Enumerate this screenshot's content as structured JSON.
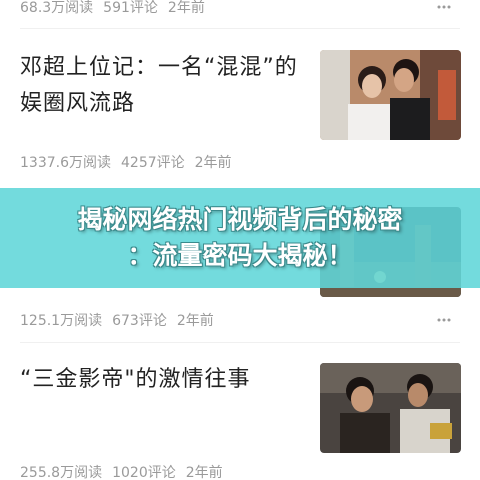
{
  "feed": {
    "items": [
      {
        "title": "",
        "reads": "68.3万阅读",
        "comments": "591评论",
        "time": "2年前"
      },
      {
        "title": "邓超上位记：一名“混混”的娱圈风流路",
        "reads": "1337.6万阅读",
        "comments": "4257评论",
        "time": "2年前"
      },
      {
        "title": "",
        "reads": "125.1万阅读",
        "comments": "673评论",
        "time": "2年前"
      },
      {
        "title": "“三金影帝\"的激情往事",
        "reads": "255.8万阅读",
        "comments": "1020评论",
        "time": "2年前"
      }
    ],
    "more_icon": "more-dots-icon"
  },
  "overlay": {
    "line1": "揭秘网络热门视频背后的秘密",
    "line2": "：流量密码大揭秘！"
  },
  "colors": {
    "overlay_bg": "#60d6d8",
    "meta_text": "#9a9a9a",
    "title_text": "#222222"
  }
}
